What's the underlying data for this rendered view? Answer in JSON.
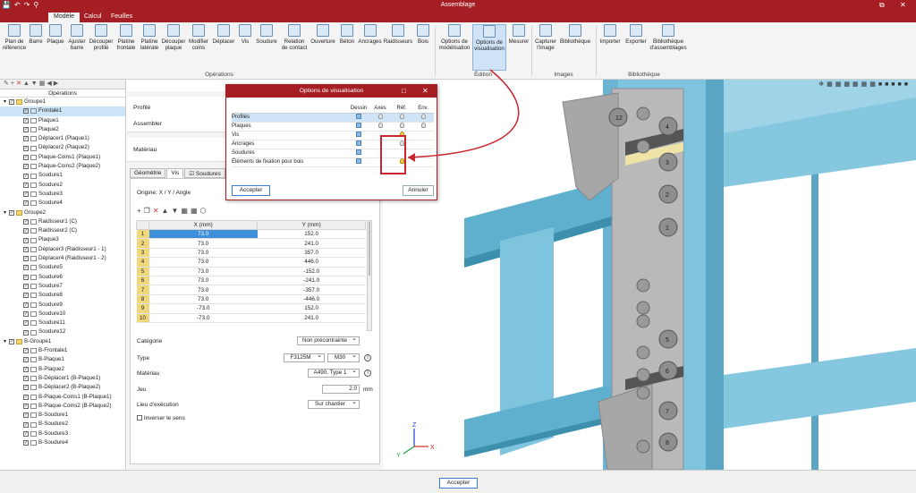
{
  "app": {
    "title": "Assemblage"
  },
  "tabs": [
    {
      "label": "Modèle",
      "active": true
    },
    {
      "label": "Calcul",
      "active": false
    },
    {
      "label": "Feuilles",
      "active": false
    }
  ],
  "ribbon": {
    "buttons": [
      {
        "label": "Plan de\nréférence",
        "icon": "reference-plane-icon"
      },
      {
        "label": "Barre",
        "icon": "bar-icon"
      },
      {
        "label": "Plaque",
        "icon": "plate-icon"
      },
      {
        "label": "Ajuster\nbarre",
        "icon": "adjust-bar-icon"
      },
      {
        "label": "Découper\nprofilé",
        "icon": "cut-profile-icon"
      },
      {
        "label": "Platine\nfrontale",
        "icon": "front-plate-icon"
      },
      {
        "label": "Platine\nlatérale",
        "icon": "side-plate-icon"
      },
      {
        "label": "Découper\nplaque",
        "icon": "cut-plate-icon"
      },
      {
        "label": "Modifier\ncoins",
        "icon": "corners-icon"
      },
      {
        "label": "Déplacer",
        "icon": "move-icon"
      },
      {
        "label": "Vis",
        "icon": "bolt-icon"
      },
      {
        "label": "Soudure",
        "icon": "weld-icon"
      },
      {
        "label": "Relation\nde contact",
        "icon": "contact-icon"
      },
      {
        "label": "Ouverture",
        "icon": "opening-icon"
      },
      {
        "label": "Béton",
        "icon": "concrete-icon"
      },
      {
        "label": "Ancrages",
        "icon": "anchor-icon"
      },
      {
        "label": "Raidisseurs",
        "icon": "stiffener-icon"
      },
      {
        "label": "Bois",
        "icon": "wood-icon"
      },
      {
        "label": "Options de\nmodélisation",
        "icon": "modeling-options-icon"
      },
      {
        "label": "Options de\nvisualisation",
        "icon": "visual-options-icon"
      },
      {
        "label": "Mesurer",
        "icon": "measure-icon"
      },
      {
        "label": "Capturer\nl'image",
        "icon": "capture-icon"
      },
      {
        "label": "Bibliothèque",
        "icon": "library-icon"
      },
      {
        "label": "Importer",
        "icon": "import-icon"
      },
      {
        "label": "Exporter",
        "icon": "export-icon"
      },
      {
        "label": "Bibliothèque\nd'assemblages",
        "icon": "assembly-library-icon"
      }
    ],
    "groups": [
      "Opérations",
      "Édition",
      "Images",
      "Bibliothèque"
    ]
  },
  "tree": {
    "header": "Opérations",
    "items": [
      {
        "label": "Groupe1",
        "level": 0,
        "type": "folder"
      },
      {
        "label": "Frontale1",
        "level": 1,
        "type": "plate",
        "selected": true
      },
      {
        "label": "Plaque1",
        "level": 1,
        "type": "plate"
      },
      {
        "label": "Plaque2",
        "level": 1,
        "type": "plate"
      },
      {
        "label": "Déplacer1 (Plaque1)",
        "level": 1,
        "type": "move"
      },
      {
        "label": "Déplacer2 (Plaque2)",
        "level": 1,
        "type": "move"
      },
      {
        "label": "Plaque-Coins1 (Plaque1)",
        "level": 1,
        "type": "corner"
      },
      {
        "label": "Plaque-Coins2 (Plaque2)",
        "level": 1,
        "type": "corner"
      },
      {
        "label": "Soudure1",
        "level": 1,
        "type": "weld"
      },
      {
        "label": "Soudure2",
        "level": 1,
        "type": "weld"
      },
      {
        "label": "Soudure3",
        "level": 1,
        "type": "weld"
      },
      {
        "label": "Soudure4",
        "level": 1,
        "type": "weld"
      },
      {
        "label": "Groupe2",
        "level": 0,
        "type": "folder"
      },
      {
        "label": "Raidisseur1 (C)",
        "level": 1,
        "type": "stiffener"
      },
      {
        "label": "Raidisseur2 (C)",
        "level": 1,
        "type": "stiffener"
      },
      {
        "label": "Plaque3",
        "level": 1,
        "type": "plate"
      },
      {
        "label": "Déplacer3 (Raidisseur1 - 1)",
        "level": 1,
        "type": "move"
      },
      {
        "label": "Déplacer4 (Raidisseur1 - 2)",
        "level": 1,
        "type": "move"
      },
      {
        "label": "Soudure5",
        "level": 1,
        "type": "weld"
      },
      {
        "label": "Soudure6",
        "level": 1,
        "type": "weld"
      },
      {
        "label": "Soudure7",
        "level": 1,
        "type": "weld"
      },
      {
        "label": "Soudure8",
        "level": 1,
        "type": "weld"
      },
      {
        "label": "Soudure9",
        "level": 1,
        "type": "weld"
      },
      {
        "label": "Soudure10",
        "level": 1,
        "type": "weld"
      },
      {
        "label": "Soudure11",
        "level": 1,
        "type": "weld"
      },
      {
        "label": "Soudure12",
        "level": 1,
        "type": "weld"
      },
      {
        "label": "B-Groupe1",
        "level": 0,
        "type": "folder"
      },
      {
        "label": "B-Frontale1",
        "level": 1,
        "type": "plate"
      },
      {
        "label": "B-Plaque1",
        "level": 1,
        "type": "plate"
      },
      {
        "label": "B-Plaque2",
        "level": 1,
        "type": "plate"
      },
      {
        "label": "B-Déplacer1 (B-Plaque1)",
        "level": 1,
        "type": "move"
      },
      {
        "label": "B-Déplacer2 (B-Plaque2)",
        "level": 1,
        "type": "move"
      },
      {
        "label": "B-Plaque-Coins1 (B-Plaque1)",
        "level": 1,
        "type": "corner"
      },
      {
        "label": "B-Plaque-Coins2 (B-Plaque2)",
        "level": 1,
        "type": "corner"
      },
      {
        "label": "B-Soudure1",
        "level": 1,
        "type": "weld"
      },
      {
        "label": "B-Soudure2",
        "level": 1,
        "type": "weld"
      },
      {
        "label": "B-Soudure3",
        "level": 1,
        "type": "weld"
      },
      {
        "label": "B-Soudure4",
        "level": 1,
        "type": "weld"
      }
    ]
  },
  "props": {
    "profil_label": "Profilé",
    "assembler_label": "Assembler",
    "materiau_label": "Matériau",
    "tabs": [
      "Géométrie",
      "Vis",
      "Soudures"
    ],
    "origin": "Origine: X / Y / Angle",
    "col_x": "X (mm)",
    "col_y": "Y (mm)",
    "rows": [
      {
        "n": "1",
        "x": "73.0",
        "y": "152.0"
      },
      {
        "n": "2",
        "x": "73.0",
        "y": "241.0"
      },
      {
        "n": "3",
        "x": "73.0",
        "y": "357.0"
      },
      {
        "n": "4",
        "x": "73.0",
        "y": "446.0"
      },
      {
        "n": "5",
        "x": "73.0",
        "y": "-152.0"
      },
      {
        "n": "6",
        "x": "73.0",
        "y": "-241.0"
      },
      {
        "n": "7",
        "x": "73.0",
        "y": "-357.0"
      },
      {
        "n": "8",
        "x": "73.0",
        "y": "-446.0"
      },
      {
        "n": "9",
        "x": "-73.0",
        "y": "152.0"
      },
      {
        "n": "10",
        "x": "-73.0",
        "y": "241.0"
      }
    ],
    "categorie_label": "Catégorie",
    "categorie_value": "Non précontrainte",
    "type_label": "Type",
    "type_value": "F3125M",
    "type_size": "M30",
    "materiau2_label": "Matériau",
    "materiau2_value": "A490, Type 1",
    "jeu_label": "Jeu",
    "jeu_value": "2.0",
    "jeu_unit": "mm",
    "lieu_label": "Lieu d'exécution",
    "lieu_value": "Sur chantier",
    "inverser_label": "Inverser le sens"
  },
  "dialog": {
    "title": "Options de visualisation",
    "cols": [
      "Dessin",
      "Axes",
      "Réf.",
      "Env."
    ],
    "rows": [
      {
        "label": "Profilés",
        "dessin": true,
        "axes": true,
        "ref": true,
        "env": true,
        "ref_on": false
      },
      {
        "label": "Plaques",
        "dessin": true,
        "axes": true,
        "ref": true,
        "env": true,
        "ref_on": false
      },
      {
        "label": "Vis",
        "dessin": true,
        "axes": false,
        "ref": true,
        "env": false,
        "ref_on": true
      },
      {
        "label": "Ancrages",
        "dessin": true,
        "axes": false,
        "ref": true,
        "env": false,
        "ref_on": false
      },
      {
        "label": "Soudures",
        "dessin": true,
        "axes": false,
        "ref": false,
        "env": false,
        "ref_on": false
      },
      {
        "label": "Éléments de fixation pour bois",
        "dessin": true,
        "axes": false,
        "ref": true,
        "env": false,
        "ref_on": true
      }
    ],
    "accept": "Accepter",
    "cancel": "Annuler"
  },
  "footer": {
    "accept": "Accepter"
  },
  "viewport": {
    "bolt_labels": [
      "12",
      "4",
      "3",
      "2",
      "1",
      "5",
      "6",
      "7",
      "8"
    ],
    "axis_labels": [
      "Z",
      "X",
      "Y"
    ]
  },
  "colors": {
    "brand": "#a41e24",
    "steel": "#7fc4de",
    "plate": "#b9b9b9",
    "highlight": "#c8262e"
  }
}
